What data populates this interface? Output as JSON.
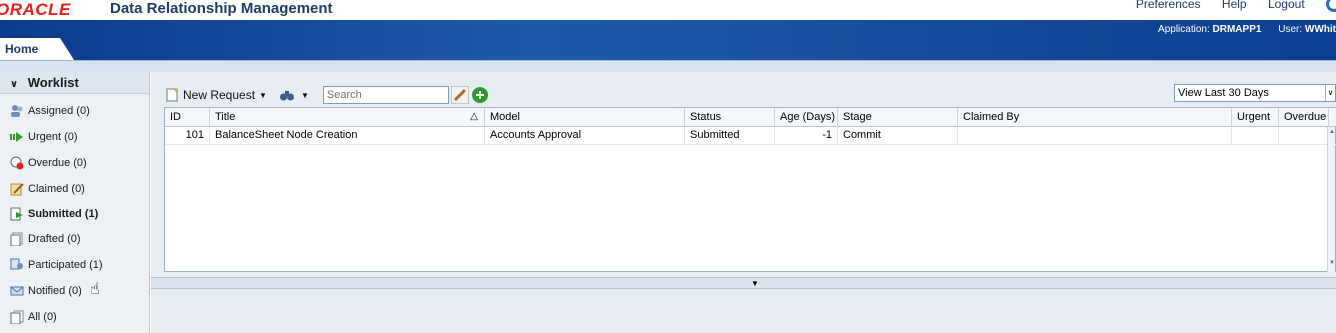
{
  "header": {
    "logo": "ORACLE",
    "app_title": "Data Relationship Management",
    "links": [
      "Preferences",
      "Help",
      "Logout"
    ],
    "application_label": "Application:",
    "application_value": "DRMAPP1",
    "user_label": "User:",
    "user_value": "WWhit"
  },
  "tabs": {
    "home": "Home"
  },
  "worklist": {
    "title": "Worklist",
    "items": [
      {
        "label": "Assigned (0)",
        "icon": "assigned-icon"
      },
      {
        "label": "Urgent (0)",
        "icon": "urgent-icon"
      },
      {
        "label": "Overdue (0)",
        "icon": "overdue-icon"
      },
      {
        "label": "Claimed (0)",
        "icon": "claimed-icon"
      },
      {
        "label": "Submitted (1)",
        "icon": "submitted-icon"
      },
      {
        "label": "Drafted (0)",
        "icon": "drafted-icon"
      },
      {
        "label": "Participated (1)",
        "icon": "participated-icon"
      },
      {
        "label": "Notified (0)",
        "icon": "notified-icon"
      },
      {
        "label": "All (0)",
        "icon": "all-icon"
      }
    ]
  },
  "toolbar": {
    "new_request": "New Request",
    "search_placeholder": "Search",
    "view_filter": "View Last 30 Days"
  },
  "table": {
    "columns": [
      "ID",
      "Title",
      "Model",
      "Status",
      "Age (Days)",
      "Stage",
      "Claimed By",
      "Urgent",
      "Overdue"
    ],
    "rows": [
      {
        "id": "101",
        "title": "BalanceSheet Node Creation",
        "model": "Accounts Approval",
        "status": "Submitted",
        "age": "-1",
        "stage": "Commit",
        "claimed_by": "",
        "urgent": "",
        "overdue": ""
      }
    ]
  }
}
